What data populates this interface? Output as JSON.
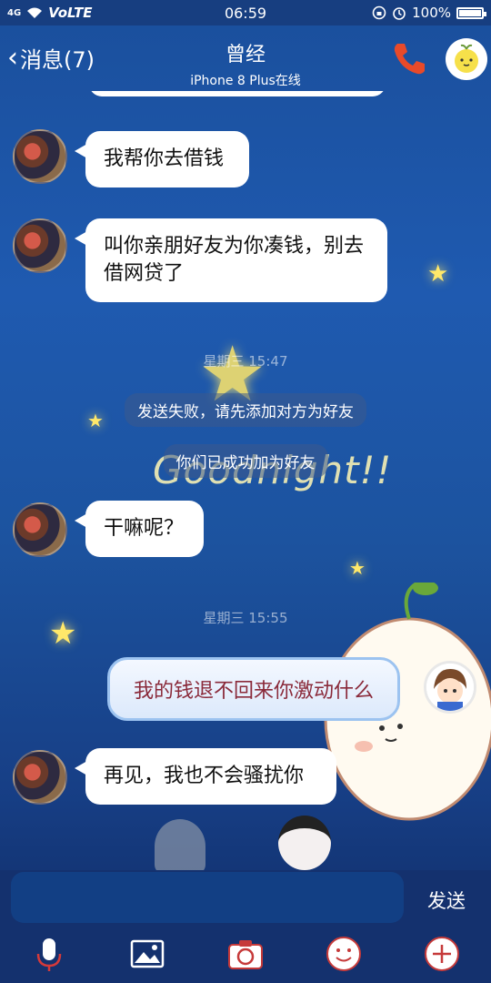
{
  "status_bar": {
    "network": "4G",
    "volte": "VoLTE",
    "time": "06:59",
    "battery": "100%"
  },
  "header": {
    "back_label": "消息(7)",
    "title": "曾经",
    "subtitle": "iPhone 8 Plus在线"
  },
  "messages": [
    {
      "from": "them",
      "text": "我帮你去借钱"
    },
    {
      "from": "them",
      "text": "叫你亲朋好友为你凑钱，别去借网贷了"
    },
    {
      "type": "time",
      "text": "星期三 15:47"
    },
    {
      "type": "system",
      "text": "发送失败，请先添加对方为好友"
    },
    {
      "type": "system",
      "text": "你们已成功加为好友"
    },
    {
      "from": "them",
      "text": "干嘛呢？"
    },
    {
      "type": "time",
      "text": "星期三 15:55"
    },
    {
      "from": "me",
      "text": "我的钱退不回来你激动什么"
    },
    {
      "from": "them",
      "text": "再见，我也不会骚扰你"
    }
  ],
  "background": {
    "caption": "Goodnight!!"
  },
  "input": {
    "placeholder": "",
    "send_label": "发送"
  },
  "toolbar": [
    "microphone-icon",
    "image-icon",
    "camera-icon",
    "emoji-icon",
    "plus-icon"
  ],
  "colors": {
    "accent_red": "#e84a2a",
    "my_text": "#8a2a3a"
  }
}
